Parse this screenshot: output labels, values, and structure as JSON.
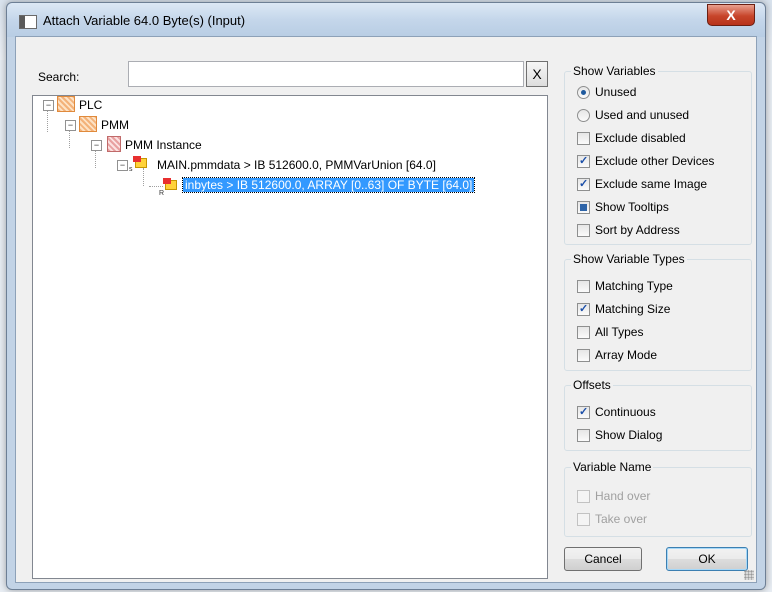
{
  "window": {
    "title": "Attach Variable 64.0 Byte(s) (Input)",
    "close_label": "X"
  },
  "search": {
    "label": "Search:",
    "value": "",
    "placeholder": "",
    "clear_label": "X"
  },
  "tree": {
    "plc": "PLC",
    "pmm": "PMM",
    "instance": "PMM Instance",
    "var1": "MAIN.pmmdata  >  IB 512600.0, PMMVarUnion [64.0]",
    "var1_badge": "s",
    "var2": "inbytes  >  IB 512600.0, ARRAY [0..63] OF BYTE [64.0]",
    "var2_badge": "R"
  },
  "show_variables": {
    "title": "Show Variables",
    "unused": "Unused",
    "used_and_unused": "Used and unused",
    "exclude_disabled": "Exclude disabled",
    "exclude_other_devices": "Exclude other Devices",
    "exclude_same_image": "Exclude same Image",
    "show_tooltips": "Show Tooltips",
    "sort_by_address": "Sort by Address"
  },
  "show_variable_types": {
    "title": "Show Variable Types",
    "matching_type": "Matching Type",
    "matching_size": "Matching Size",
    "all_types": "All Types",
    "array_mode": "Array Mode"
  },
  "offsets": {
    "title": "Offsets",
    "continuous": "Continuous",
    "show_dialog": "Show Dialog"
  },
  "variable_name": {
    "title": "Variable Name",
    "hand_over": "Hand over",
    "take_over": "Take over"
  },
  "buttons": {
    "cancel": "Cancel",
    "ok": "OK"
  }
}
